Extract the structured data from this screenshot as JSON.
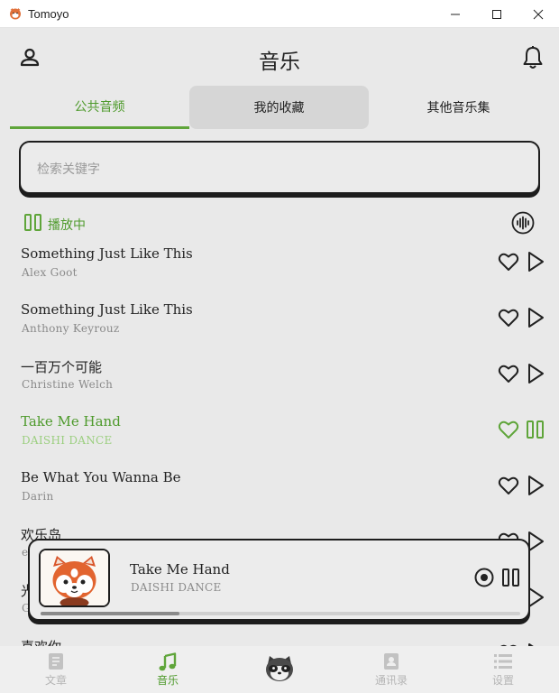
{
  "window": {
    "title": "Tomoyo",
    "controls": [
      "minimize",
      "maximize",
      "close"
    ]
  },
  "header": {
    "title": "音乐",
    "left_icon": "user-icon",
    "right_icon": "bell-icon"
  },
  "tabs": [
    {
      "label": "公共音频",
      "active": true
    },
    {
      "label": "我的收藏",
      "active": false
    },
    {
      "label": "其他音乐集",
      "active": false
    }
  ],
  "search": {
    "placeholder": "检索关键字",
    "value": ""
  },
  "status": {
    "label": "播放中",
    "icon": "pause-icon",
    "right_icon": "audio-wave-icon"
  },
  "songs": [
    {
      "title": "Something Just Like This",
      "artist": "Alex Goot",
      "playing": false
    },
    {
      "title": "Something Just Like This",
      "artist": "Anthony Keyrouz",
      "playing": false
    },
    {
      "title": "一百万个可能",
      "artist": "Christine Welch",
      "playing": false
    },
    {
      "title": "Take Me Hand",
      "artist": "DAISHI DANCE",
      "playing": true
    },
    {
      "title": "Be What You Wanna Be",
      "artist": "Darin",
      "playing": false
    },
    {
      "title": "欢乐岛",
      "artist": "e",
      "playing": false
    },
    {
      "title": "光",
      "artist": "G",
      "playing": false
    },
    {
      "title": "喜欢你",
      "artist": "",
      "playing": false
    }
  ],
  "player": {
    "title": "Take Me Hand",
    "artist": "DAISHI DANCE",
    "cover": "red-panda-avatar",
    "progress": 0.29
  },
  "nav": [
    {
      "label": "文章",
      "icon": "article-icon",
      "active": false
    },
    {
      "label": "音乐",
      "icon": "music-note-icon",
      "active": true
    },
    {
      "label": "",
      "icon": "raccoon-icon",
      "active": false
    },
    {
      "label": "通讯录",
      "icon": "contacts-icon",
      "active": false
    },
    {
      "label": "设置",
      "icon": "settings-list-icon",
      "active": false
    }
  ],
  "colors": {
    "accent": "#4e9a2c",
    "accent_light": "#9ccf80",
    "background": "#e9e9e9",
    "outline": "#1d1d1d"
  }
}
